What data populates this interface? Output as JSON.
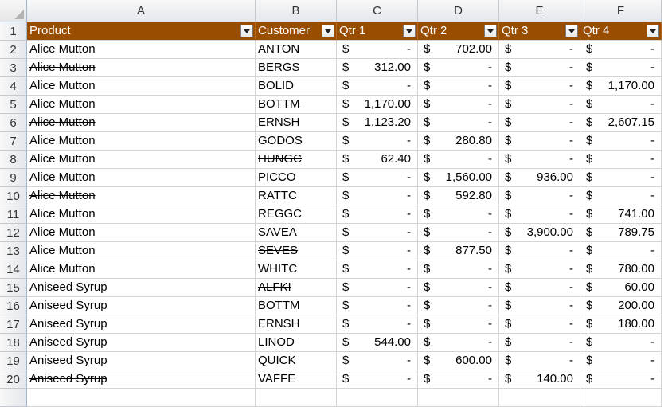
{
  "columns": [
    {
      "letter": "A"
    },
    {
      "letter": "B"
    },
    {
      "letter": "C"
    },
    {
      "letter": "D"
    },
    {
      "letter": "E"
    },
    {
      "letter": "F"
    }
  ],
  "header": {
    "row_number": "1",
    "labels": [
      "Product",
      "Customer",
      "Qtr 1",
      "Qtr 2",
      "Qtr 3",
      "Qtr 4"
    ]
  },
  "currency_symbol": "$",
  "rows": [
    {
      "num": "2",
      "product": "Alice Mutton",
      "product_strike": false,
      "customer": "ANTON",
      "customer_strike": false,
      "q": [
        "-",
        "702.00",
        "-",
        "-"
      ]
    },
    {
      "num": "3",
      "product": "Alice Mutton",
      "product_strike": true,
      "customer": "BERGS",
      "customer_strike": false,
      "q": [
        "312.00",
        "-",
        "-",
        "-"
      ]
    },
    {
      "num": "4",
      "product": "Alice Mutton",
      "product_strike": false,
      "customer": "BOLID",
      "customer_strike": false,
      "q": [
        "-",
        "-",
        "-",
        "1,170.00"
      ]
    },
    {
      "num": "5",
      "product": "Alice Mutton",
      "product_strike": false,
      "customer": "BOTTM",
      "customer_strike": true,
      "q": [
        "1,170.00",
        "-",
        "-",
        "-"
      ]
    },
    {
      "num": "6",
      "product": "Alice Mutton",
      "product_strike": true,
      "customer": "ERNSH",
      "customer_strike": false,
      "q": [
        "1,123.20",
        "-",
        "-",
        "2,607.15"
      ]
    },
    {
      "num": "7",
      "product": "Alice Mutton",
      "product_strike": false,
      "customer": "GODOS",
      "customer_strike": false,
      "q": [
        "-",
        "280.80",
        "-",
        "-"
      ]
    },
    {
      "num": "8",
      "product": "Alice Mutton",
      "product_strike": false,
      "customer": "HUNGC",
      "customer_strike": true,
      "q": [
        "62.40",
        "-",
        "-",
        "-"
      ]
    },
    {
      "num": "9",
      "product": "Alice Mutton",
      "product_strike": false,
      "customer": "PICCO",
      "customer_strike": false,
      "q": [
        "-",
        "1,560.00",
        "936.00",
        "-"
      ]
    },
    {
      "num": "10",
      "product": "Alice Mutton",
      "product_strike": true,
      "customer": "RATTC",
      "customer_strike": false,
      "q": [
        "-",
        "592.80",
        "-",
        "-"
      ]
    },
    {
      "num": "11",
      "product": "Alice Mutton",
      "product_strike": false,
      "customer": "REGGC",
      "customer_strike": false,
      "q": [
        "-",
        "-",
        "-",
        "741.00"
      ]
    },
    {
      "num": "12",
      "product": "Alice Mutton",
      "product_strike": false,
      "customer": "SAVEA",
      "customer_strike": false,
      "q": [
        "-",
        "-",
        "3,900.00",
        "789.75"
      ]
    },
    {
      "num": "13",
      "product": "Alice Mutton",
      "product_strike": false,
      "customer": "SEVES",
      "customer_strike": true,
      "q": [
        "-",
        "877.50",
        "-",
        "-"
      ]
    },
    {
      "num": "14",
      "product": "Alice Mutton",
      "product_strike": false,
      "customer": "WHITC",
      "customer_strike": false,
      "q": [
        "-",
        "-",
        "-",
        "780.00"
      ]
    },
    {
      "num": "15",
      "product": "Aniseed Syrup",
      "product_strike": false,
      "customer": "ALFKI",
      "customer_strike": true,
      "q": [
        "-",
        "-",
        "-",
        "60.00"
      ]
    },
    {
      "num": "16",
      "product": "Aniseed Syrup",
      "product_strike": false,
      "customer": "BOTTM",
      "customer_strike": false,
      "q": [
        "-",
        "-",
        "-",
        "200.00"
      ]
    },
    {
      "num": "17",
      "product": "Aniseed Syrup",
      "product_strike": false,
      "customer": "ERNSH",
      "customer_strike": false,
      "q": [
        "-",
        "-",
        "-",
        "180.00"
      ]
    },
    {
      "num": "18",
      "product": "Aniseed Syrup",
      "product_strike": true,
      "customer": "LINOD",
      "customer_strike": false,
      "q": [
        "544.00",
        "-",
        "-",
        "-"
      ]
    },
    {
      "num": "19",
      "product": "Aniseed Syrup",
      "product_strike": false,
      "customer": "QUICK",
      "customer_strike": false,
      "q": [
        "-",
        "600.00",
        "-",
        "-"
      ]
    },
    {
      "num": "20",
      "product": "Aniseed Syrup",
      "product_strike": true,
      "customer": "VAFFE",
      "customer_strike": false,
      "q": [
        "-",
        "-",
        "140.00",
        "-"
      ]
    }
  ],
  "colors": {
    "header_fill": "#994d00",
    "header_text": "#ffffff",
    "gridline": "#d4d4d4"
  }
}
